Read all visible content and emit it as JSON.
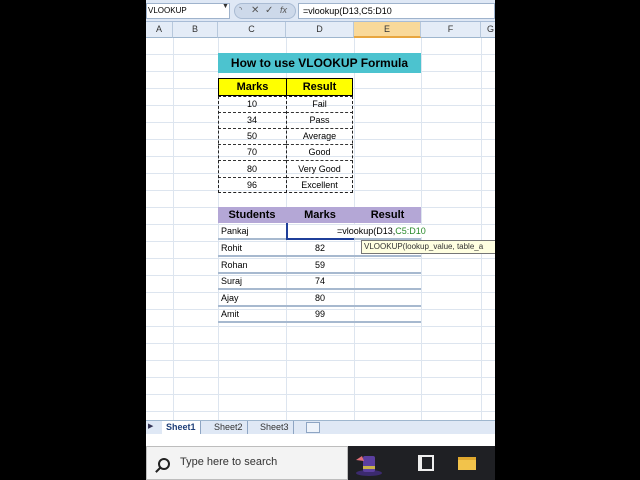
{
  "formula_bar": {
    "name_box": "VLOOKUP",
    "cancel_icon": "✕",
    "enter_icon": "✓",
    "fx_label": "fx",
    "formula": "=vlookup(D13,C5:D10"
  },
  "columns": [
    "A",
    "B",
    "C",
    "D",
    "E",
    "F",
    "G"
  ],
  "title": "How to use VLOOKUP Formula",
  "table1": {
    "headers": [
      "Marks",
      "Result"
    ],
    "rows": [
      {
        "marks": "10",
        "result": "Fail"
      },
      {
        "marks": "34",
        "result": "Pass"
      },
      {
        "marks": "50",
        "result": "Average"
      },
      {
        "marks": "70",
        "result": "Good"
      },
      {
        "marks": "80",
        "result": "Very Good"
      },
      {
        "marks": "96",
        "result": "Excellent"
      }
    ]
  },
  "table2": {
    "headers": [
      "Students",
      "Marks",
      "Result"
    ],
    "rows": [
      {
        "name": "Pankaj",
        "marks": ""
      },
      {
        "name": "Rohit",
        "marks": "82"
      },
      {
        "name": "Rohan",
        "marks": "59"
      },
      {
        "name": "Suraj",
        "marks": "74"
      },
      {
        "name": "Ajay",
        "marks": "80"
      },
      {
        "name": "Amit",
        "marks": "99"
      }
    ]
  },
  "cell_edit": {
    "prefix": "=vlookup(D13,",
    "range": "C5:D10"
  },
  "tooltip": "VLOOKUP(lookup_value, table_a",
  "sheet_tabs": [
    "Sheet1",
    "Sheet2",
    "Sheet3"
  ],
  "taskbar": {
    "search_placeholder": "Type here to search"
  },
  "colors": {
    "title_bg": "#4cc3cf",
    "table1_header": "#ffff00",
    "table2_header": "#b4a7d6"
  }
}
